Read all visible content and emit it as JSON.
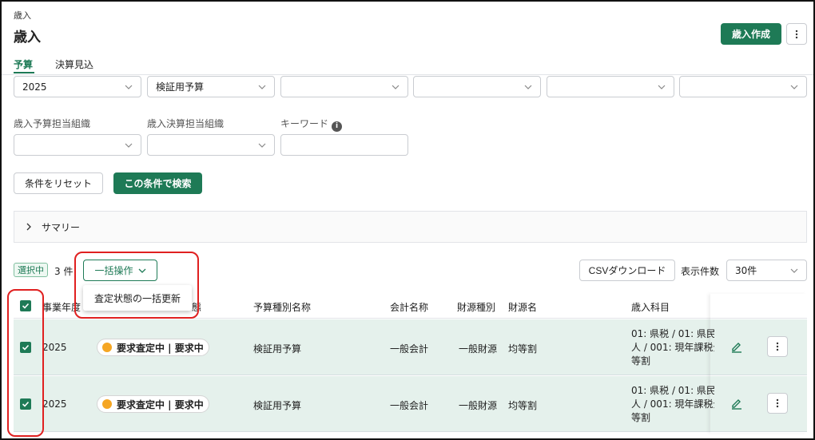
{
  "header": {
    "breadcrumb": "歳入",
    "title": "歳入",
    "create_label": "歳入作成"
  },
  "tabs": [
    {
      "label": "予算",
      "active": true
    },
    {
      "label": "決算見込",
      "active": false
    }
  ],
  "filters": {
    "row1": [
      {
        "value": "2025"
      },
      {
        "value": "検証用予算"
      },
      {
        "value": ""
      },
      {
        "value": ""
      },
      {
        "value": ""
      },
      {
        "value": ""
      }
    ],
    "budget_org_label": "歳入予算担当組織",
    "settlement_org_label": "歳入決算担当組織",
    "keyword_label": "キーワード",
    "reset_label": "条件をリセット",
    "search_label": "この条件で検索"
  },
  "summary": {
    "label": "サマリー"
  },
  "toolbar": {
    "selected_badge": "選択中",
    "count_text": "3 件",
    "bulk_label": "一括操作",
    "bulk_menu_item": "査定状態の一括更新",
    "csv_label": "CSVダウンロード",
    "per_page_label": "表示件数",
    "per_page_value": "30件"
  },
  "table": {
    "columns": [
      "事業年度",
      "態",
      "予算種別名称",
      "会計名称",
      "財源種別",
      "財源名",
      "歳入科目"
    ],
    "rows": [
      {
        "year": "2025",
        "status": "要求査定中 | 要求中",
        "budget_type": "検証用予算",
        "account": "一般会計",
        "fund_type": "一般財源",
        "fund_name": "均等割",
        "subject_1": "01: 県税 / 01: 県民税",
        "subject_2": "人 / 001: 現年課税分",
        "subject_3": "等割"
      },
      {
        "year": "2025",
        "status": "要求査定中 | 要求中",
        "budget_type": "検証用予算",
        "account": "一般会計",
        "fund_type": "一般財源",
        "fund_name": "均等割",
        "subject_1": "01: 県税 / 01: 県民税",
        "subject_2": "人 / 001: 現年課税分",
        "subject_3": "等割"
      }
    ]
  },
  "colors": {
    "primary": "#1e7a56",
    "selected_row": "#e5f1ec",
    "status_dot": "#f5a623",
    "annotation": "#e02020"
  }
}
